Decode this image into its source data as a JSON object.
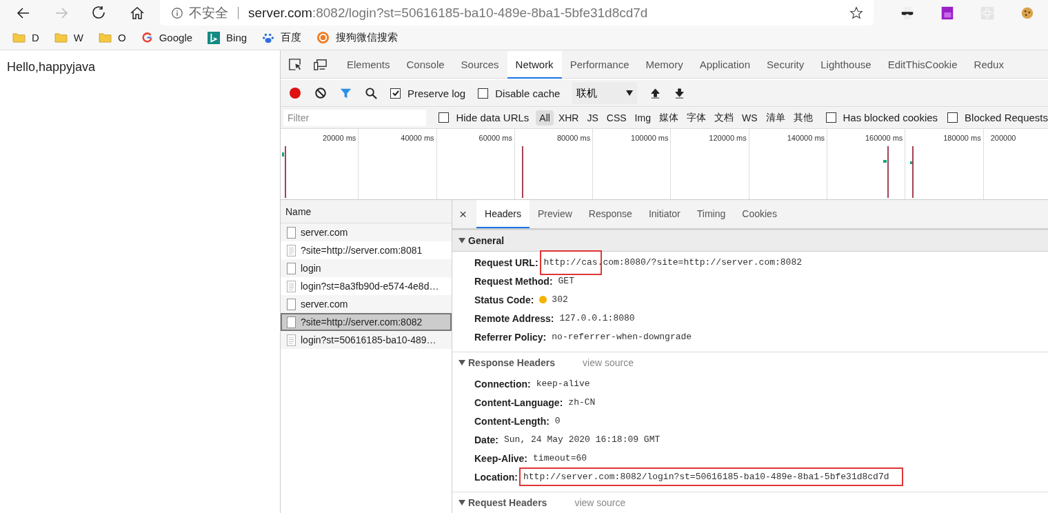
{
  "browser": {
    "nav": [
      {
        "kind": "back",
        "disabled": false
      },
      {
        "kind": "forward",
        "disabled": true
      },
      {
        "kind": "reload",
        "disabled": false
      },
      {
        "kind": "home",
        "disabled": false
      }
    ],
    "address": {
      "security": "不安全",
      "host": "server.com",
      "path": ":8082/login?st=50616185-ba10-489e-8ba1-5bfe31d8cd7d"
    },
    "extensions": [
      {
        "kind": "mask"
      },
      {
        "kind": "rp"
      },
      {
        "kind": "react"
      },
      {
        "kind": "cookie"
      }
    ],
    "bookmarks": [
      {
        "kind": "folder",
        "label": "D"
      },
      {
        "kind": "folder",
        "label": "W"
      },
      {
        "kind": "folder",
        "label": "O"
      },
      {
        "kind": "google",
        "label": "Google"
      },
      {
        "kind": "bing",
        "label": "Bing"
      },
      {
        "kind": "paw",
        "label": "百度"
      },
      {
        "kind": "sogou",
        "label": "搜狗微信搜索"
      }
    ]
  },
  "page": {
    "text": "Hello,happyjava"
  },
  "devtools": {
    "panels": [
      {
        "label": "Elements",
        "selected": false
      },
      {
        "label": "Console",
        "selected": false
      },
      {
        "label": "Sources",
        "selected": false
      },
      {
        "label": "Network",
        "selected": true
      },
      {
        "label": "Performance",
        "selected": false
      },
      {
        "label": "Memory",
        "selected": false
      },
      {
        "label": "Application",
        "selected": false
      },
      {
        "label": "Security",
        "selected": false
      },
      {
        "label": "Lighthouse",
        "selected": false
      },
      {
        "label": "EditThisCookie",
        "selected": false
      },
      {
        "label": "Redux",
        "selected": false
      }
    ],
    "toolbar": {
      "recording": true,
      "preserve_log": {
        "label": "Preserve log",
        "checked": true
      },
      "disable_cache": {
        "label": "Disable cache",
        "checked": false
      },
      "throttle": "联机"
    },
    "filter": {
      "placeholder": "Filter",
      "hide_data_urls": {
        "label": "Hide data URLs",
        "checked": false
      },
      "types": [
        {
          "label": "All",
          "selected": true
        },
        {
          "label": "XHR",
          "selected": false
        },
        {
          "label": "JS",
          "selected": false
        },
        {
          "label": "CSS",
          "selected": false
        },
        {
          "label": "Img",
          "selected": false
        },
        {
          "label": "媒体",
          "selected": false
        },
        {
          "label": "字体",
          "selected": false
        },
        {
          "label": "文档",
          "selected": false
        },
        {
          "label": "WS",
          "selected": false
        },
        {
          "label": "清单",
          "selected": false
        },
        {
          "label": "其他",
          "selected": false
        }
      ],
      "blocked_cookies": {
        "label": "Has blocked cookies",
        "checked": false
      },
      "blocked_requests": {
        "label": "Blocked Requests",
        "checked": false
      }
    },
    "timeline": {
      "ticks": [
        "20000 ms",
        "40000 ms",
        "60000 ms",
        "80000 ms",
        "100000 ms",
        "120000 ms",
        "140000 ms",
        "160000 ms",
        "180000 ms",
        "200000"
      ]
    },
    "requests": {
      "header": "Name",
      "rows": [
        {
          "name": "server.com",
          "kind": "plain",
          "selected": false
        },
        {
          "name": "?site=http://server.com:8081",
          "kind": "lined",
          "selected": false
        },
        {
          "name": "login",
          "kind": "plain",
          "selected": false
        },
        {
          "name": "login?st=8a3fb90d-e574-4e8d…",
          "kind": "lined",
          "selected": false
        },
        {
          "name": "server.com",
          "kind": "plain",
          "selected": false
        },
        {
          "name": "?site=http://server.com:8082",
          "kind": "plain",
          "selected": true
        },
        {
          "name": "login?st=50616185-ba10-489…",
          "kind": "lined",
          "selected": false
        }
      ]
    },
    "detail": {
      "close": "×",
      "tabs": [
        {
          "label": "Headers",
          "selected": true
        },
        {
          "label": "Preview",
          "selected": false
        },
        {
          "label": "Response",
          "selected": false
        },
        {
          "label": "Initiator",
          "selected": false
        },
        {
          "label": "Timing",
          "selected": false
        },
        {
          "label": "Cookies",
          "selected": false
        }
      ],
      "sections": [
        {
          "title": "General",
          "shaded": true,
          "expanded": true,
          "headers": [
            {
              "name": "Request URL:",
              "value": "http://cas.com:8080/?site=http://server.com:8082",
              "start_highlighted": true
            },
            {
              "name": "Request Method:",
              "value": "GET"
            },
            {
              "name": "Status Code:",
              "value": "302",
              "color": "#f5b400"
            },
            {
              "name": "Remote Address:",
              "value": "127.0.0.1:8080"
            },
            {
              "name": "Referrer Policy:",
              "value": "no-referrer-when-downgrade"
            }
          ]
        },
        {
          "title": "Response Headers",
          "shaded": false,
          "expanded": true,
          "link": "view source",
          "headers": [
            {
              "name": "Connection:",
              "value": "keep-alive"
            },
            {
              "name": "Content-Language:",
              "value": "zh-CN"
            },
            {
              "name": "Content-Length:",
              "value": "0"
            },
            {
              "name": "Date:",
              "value": "Sun, 24 May 2020 16:18:09 GMT"
            },
            {
              "name": "Keep-Alive:",
              "value": "timeout=60"
            },
            {
              "name": "Location:",
              "value": "http://server.com:8082/login?st=50616185-ba10-489e-8ba1-5bfe31d8cd7d",
              "highlighted": true
            }
          ]
        },
        {
          "title": "Request Headers",
          "shaded": false,
          "expanded": true,
          "link": "view source"
        }
      ]
    }
  }
}
